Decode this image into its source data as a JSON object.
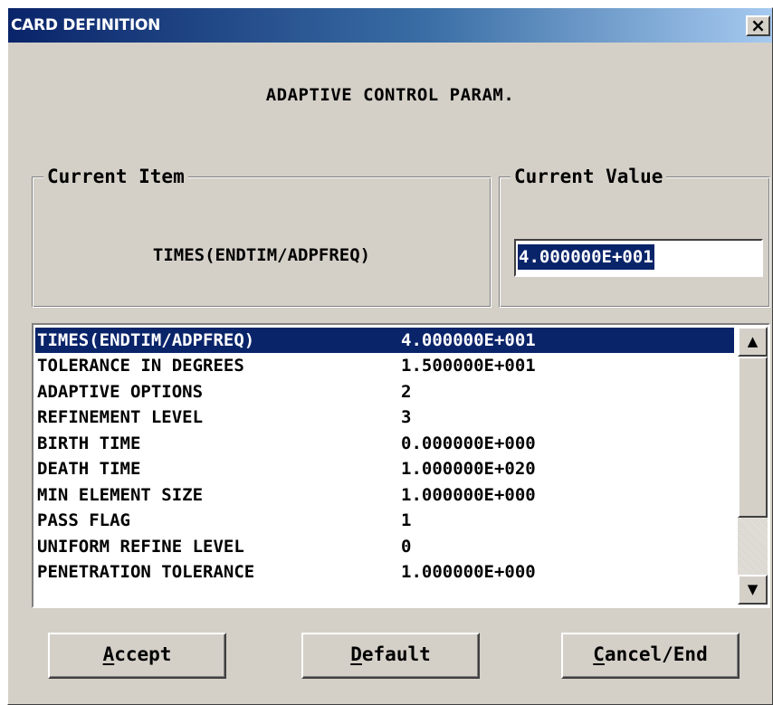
{
  "window": {
    "title": "CARD DEFINITION",
    "close_glyph": "×"
  },
  "main": {
    "heading": "ADAPTIVE CONTROL PARAM."
  },
  "current_item": {
    "legend": "Current Item",
    "value": "TIMES(ENDTIM/ADPFREQ)"
  },
  "current_value": {
    "legend": "Current Value",
    "value": "4.000000E+001"
  },
  "list": {
    "items": [
      {
        "name": "TIMES(ENDTIM/ADPFREQ)",
        "value": "4.000000E+001",
        "selected": true
      },
      {
        "name": "TOLERANCE IN DEGREES",
        "value": "1.500000E+001",
        "selected": false
      },
      {
        "name": "ADAPTIVE OPTIONS",
        "value": "2",
        "selected": false
      },
      {
        "name": "REFINEMENT LEVEL",
        "value": "3",
        "selected": false
      },
      {
        "name": "BIRTH TIME",
        "value": "0.000000E+000",
        "selected": false
      },
      {
        "name": "DEATH TIME",
        "value": "1.000000E+020",
        "selected": false
      },
      {
        "name": "MIN ELEMENT SIZE",
        "value": "1.000000E+000",
        "selected": false
      },
      {
        "name": "PASS FLAG",
        "value": "1",
        "selected": false
      },
      {
        "name": "UNIFORM REFINE LEVEL",
        "value": "0",
        "selected": false
      },
      {
        "name": "PENETRATION TOLERANCE",
        "value": "1.000000E+000",
        "selected": false
      }
    ]
  },
  "scrollbar": {
    "up_glyph": "▲",
    "down_glyph": "▼"
  },
  "buttons": {
    "accept": {
      "mnemonic": "A",
      "rest": "ccept"
    },
    "default": {
      "mnemonic": "D",
      "rest": "efault"
    },
    "cancel": {
      "mnemonic": "C",
      "rest": "ancel/End"
    }
  },
  "colors": {
    "title_start": "#0a246a",
    "title_end": "#a6caf0",
    "dialog_background": "#d4d0c8",
    "selection": "#0a246a",
    "selection_text": "#ffffff"
  },
  "icons": {
    "close": "close-icon",
    "scroll_up": "chevron-up-icon",
    "scroll_down": "chevron-down-icon"
  }
}
